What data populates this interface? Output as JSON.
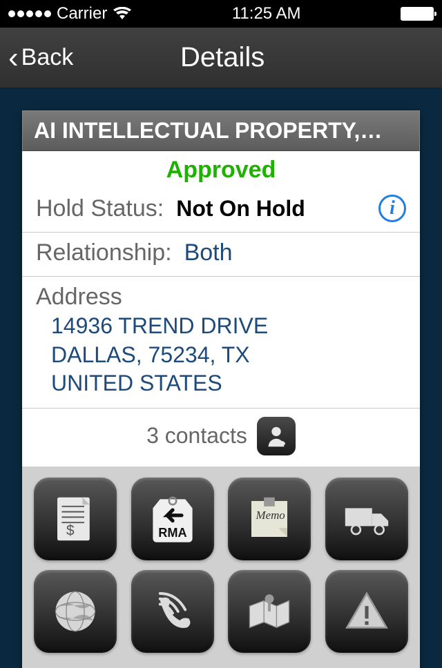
{
  "statusbar": {
    "carrier": "Carrier",
    "time": "11:25 AM"
  },
  "nav": {
    "back": "Back",
    "title": "Details"
  },
  "card": {
    "title": "AI INTELLECTUAL PROPERTY,…",
    "approvalStatus": "Approved",
    "holdStatus": {
      "label": "Hold Status:",
      "value": "Not On Hold"
    },
    "relationship": {
      "label": "Relationship:",
      "value": "Both"
    },
    "address": {
      "label": "Address",
      "line1": "14936 TREND DRIVE",
      "line2": "DALLAS, 75234, TX",
      "line3": "UNITED STATES"
    },
    "contacts": {
      "count": "3 contacts"
    },
    "actions": [
      {
        "name": "invoice-icon"
      },
      {
        "name": "rma-icon"
      },
      {
        "name": "memo-icon"
      },
      {
        "name": "truck-icon"
      },
      {
        "name": "globe-icon"
      },
      {
        "name": "call-log-icon"
      },
      {
        "name": "map-marker-icon"
      },
      {
        "name": "alert-icon"
      }
    ]
  },
  "iconLabels": {
    "rma": "RMA",
    "memo": "Memo"
  }
}
